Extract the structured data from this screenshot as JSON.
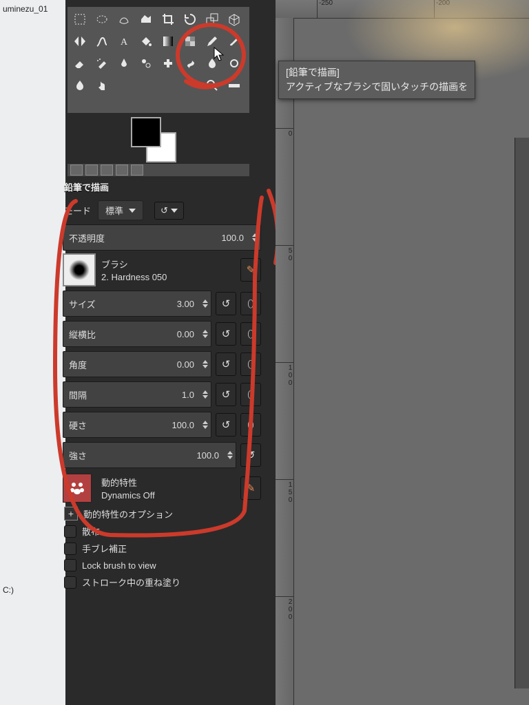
{
  "toolbox": {
    "tools": [
      "rect-select",
      "ellipse-select",
      "free-select",
      "fuzzy-select",
      "by-color-select",
      "scissors",
      "foreground-select",
      "paths",
      "color-picker",
      "measure",
      "move",
      "align",
      "crop",
      "rotate",
      "scale",
      "shear",
      "perspective",
      "flip",
      "cage",
      "warp",
      "text",
      "bucket-fill",
      "gradient",
      "pencil",
      "paintbrush",
      "eraser",
      "airbrush",
      "ink",
      "mypaint",
      "clone",
      "heal",
      "perspective-clone",
      "blur",
      "smudge",
      "dodge",
      "",
      "",
      "",
      "",
      ""
    ]
  },
  "tooltip": {
    "title": "[鉛筆で描画]",
    "body": "アクティブなブラシで固いタッチの描画を"
  },
  "options": {
    "title": "鉛筆で描画",
    "mode_label": "モード",
    "mode_value": "標準",
    "opacity_label": "不透明度",
    "opacity_value": "100.0",
    "brush_section": "ブラシ",
    "brush_name": "2. Hardness 050",
    "params": [
      {
        "label": "サイズ",
        "value": "3.00",
        "reset": true,
        "link": true
      },
      {
        "label": "縦横比",
        "value": "0.00",
        "reset": true,
        "link": true
      },
      {
        "label": "角度",
        "value": "0.00",
        "reset": true,
        "link": true
      },
      {
        "label": "間隔",
        "value": "1.0",
        "reset": true,
        "link": true
      },
      {
        "label": "硬さ",
        "value": "100.0",
        "reset": true,
        "link": true
      },
      {
        "label": "強さ",
        "value": "100.0",
        "reset": true,
        "link": false
      }
    ],
    "dynamics_label": "動的特性",
    "dynamics_value": "Dynamics Off",
    "checkboxes": [
      {
        "label": "動的特性のオプション",
        "expand": true
      },
      {
        "label": "散布",
        "expand": false
      },
      {
        "label": "手ブレ補正",
        "expand": false
      },
      {
        "label": "Lock brush to view",
        "expand": false
      },
      {
        "label": "ストローク中の重ね塗り",
        "expand": false
      }
    ]
  },
  "left": {
    "file": "uminezu_01",
    "drive": "C:)"
  },
  "ruler": {
    "h": [
      "-250",
      "-200"
    ],
    "v": [
      "0",
      "50",
      "100",
      "150",
      "200"
    ]
  },
  "icons": {
    "reset": "↺",
    "link": "⬯",
    "edit": "✎",
    "plus": "+"
  }
}
